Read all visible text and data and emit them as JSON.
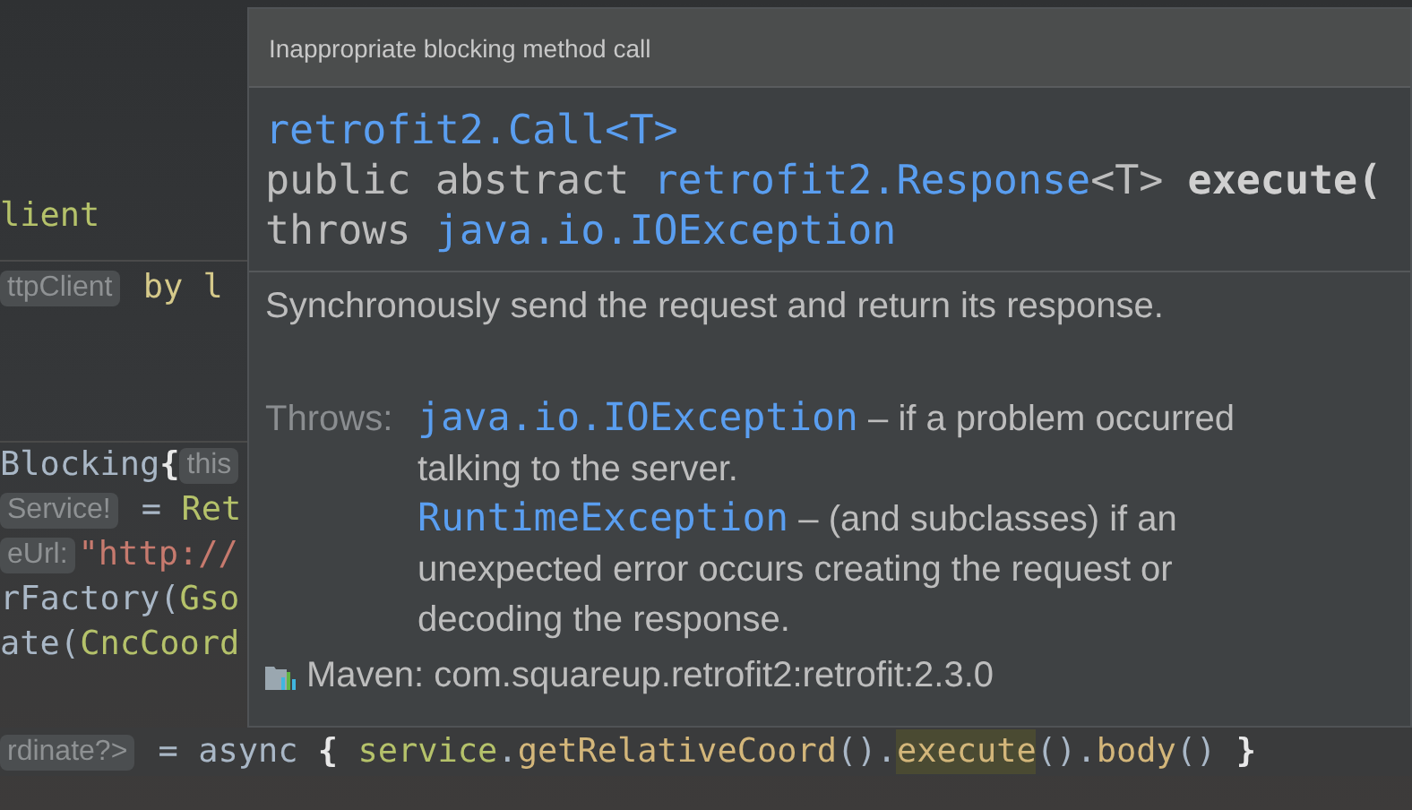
{
  "editor": {
    "blocks": [
      {
        "lines": [
          [
            {
              "kind": "string",
              "text": "lient"
            }
          ]
        ]
      },
      {
        "lines": [
          [
            {
              "kind": "hint",
              "text": "ttpClient"
            },
            {
              "kind": "keyword",
              "text": " by l"
            }
          ]
        ]
      },
      {
        "lines": [
          [
            {
              "kind": "plain",
              "text": "Blocking"
            },
            {
              "kind": "brace",
              "text": "{"
            },
            {
              "kind": "hint",
              "text": "this"
            }
          ],
          [
            {
              "kind": "hint",
              "text": "Service!"
            },
            {
              "kind": "plain",
              "text": " = "
            },
            {
              "kind": "string",
              "text": "Ret"
            }
          ],
          [
            {
              "kind": "hint",
              "text": "eUrl:"
            },
            {
              "kind": "url",
              "text": "\"http://"
            }
          ],
          [
            {
              "kind": "plain",
              "text": "rFactory("
            },
            {
              "kind": "string",
              "text": "Gso"
            }
          ],
          [
            {
              "kind": "plain",
              "text": "ate("
            },
            {
              "kind": "string",
              "text": "CncCoord"
            }
          ]
        ]
      },
      {
        "current": true,
        "lines": [
          [
            {
              "kind": "hint",
              "text": "rdinate?>"
            },
            {
              "kind": "plain",
              "text": " = async "
            },
            {
              "kind": "brace",
              "text": "{"
            },
            {
              "kind": "string",
              "text": " service"
            },
            {
              "kind": "plain",
              "text": "."
            },
            {
              "kind": "call",
              "text": "getRelativeCoord"
            },
            {
              "kind": "plain",
              "text": "()."
            },
            {
              "kind": "call",
              "text": "execute",
              "highlighted": true
            },
            {
              "kind": "plain",
              "text": "()."
            },
            {
              "kind": "call",
              "text": "body"
            },
            {
              "kind": "plain",
              "text": "() "
            },
            {
              "kind": "brace",
              "text": "}"
            }
          ]
        ]
      }
    ]
  },
  "popup": {
    "title": "Inappropriate blocking method call",
    "signature": [
      [
        {
          "kind": "link",
          "text": "retrofit2.Call<T>"
        }
      ],
      [
        {
          "kind": "plain",
          "text": "public abstract "
        },
        {
          "kind": "link",
          "text": "retrofit2.Response"
        },
        {
          "kind": "plain",
          "text": "<T> "
        },
        {
          "kind": "bold",
          "text": "execute("
        }
      ],
      [
        {
          "kind": "plain",
          "text": "throws "
        },
        {
          "kind": "link",
          "text": "java.io.IOException"
        }
      ]
    ],
    "description": "Synchronously send the request and return its response.",
    "throws_label": "Throws:",
    "throws": [
      {
        "exception": "java.io.IOException",
        "text": " – if a problem occurred talking to the server."
      },
      {
        "exception": "RuntimeException",
        "text": " – (and subclasses) if an unexpected error occurs creating the request or decoding the response."
      }
    ],
    "source": "Maven: com.squareup.retrofit2:retrofit:2.3.0"
  }
}
